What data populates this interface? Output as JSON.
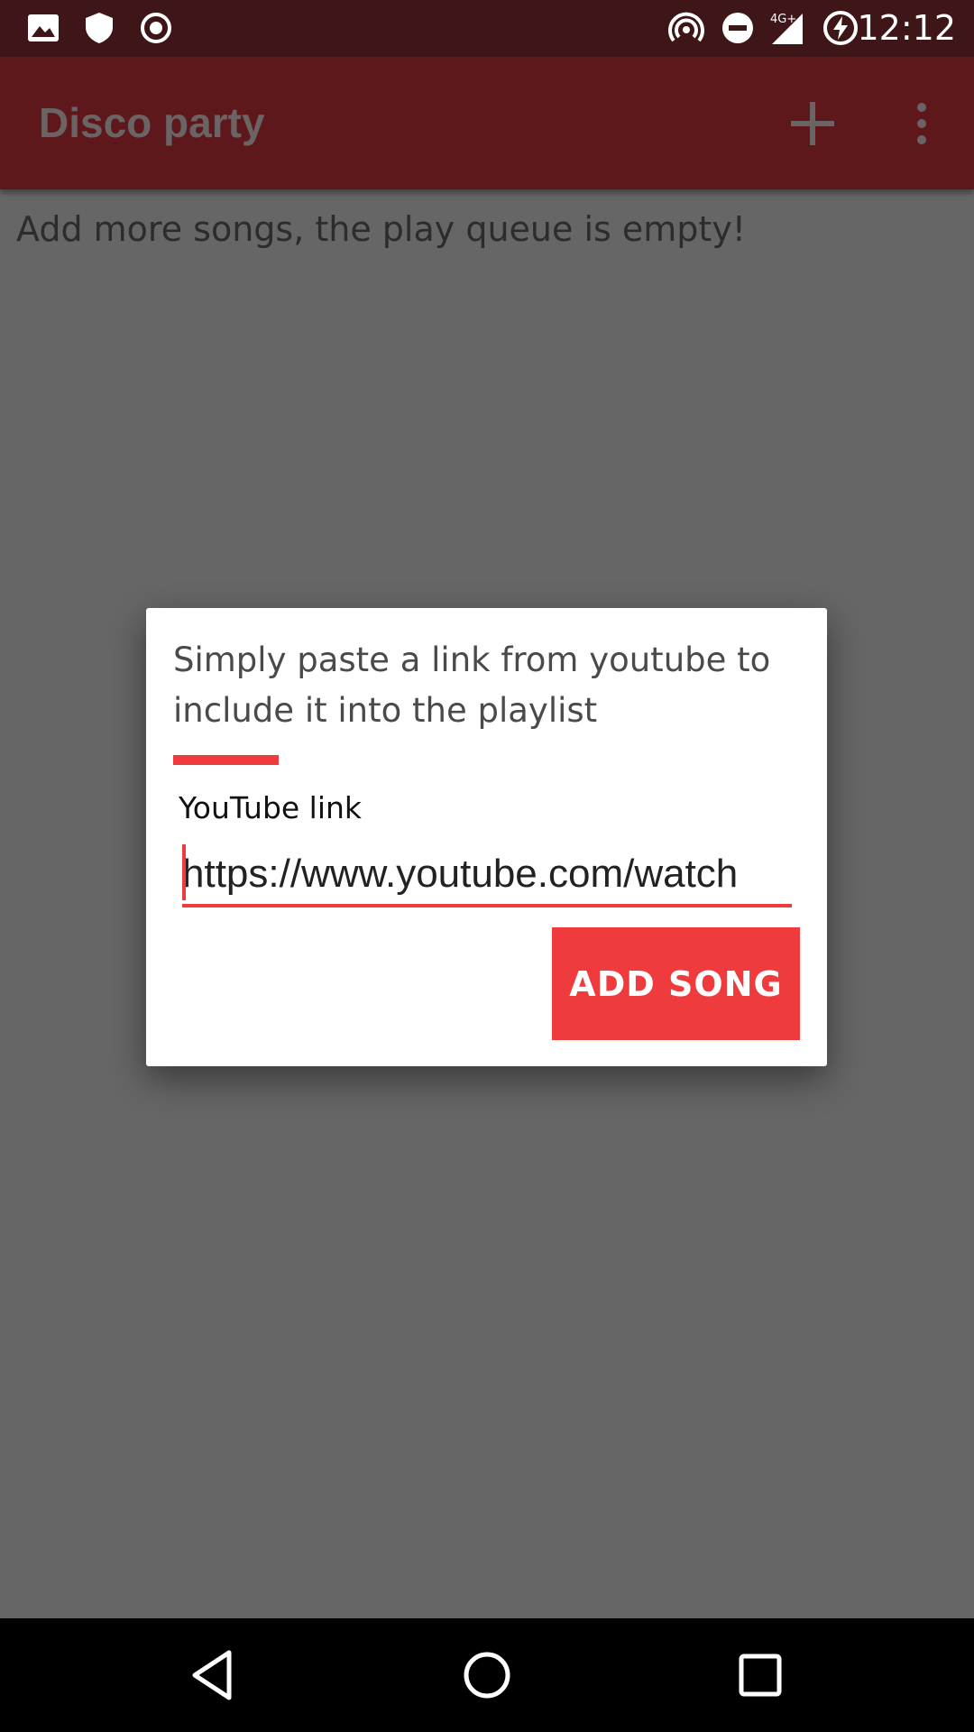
{
  "status_bar": {
    "time": "12:12",
    "network": "4G+",
    "icons": [
      "image-icon",
      "shield-icon",
      "record-icon",
      "hotspot-icon",
      "do-not-disturb-icon",
      "signal-icon",
      "battery-charging-icon"
    ]
  },
  "app_bar": {
    "title": "Disco party",
    "actions": [
      "add-icon",
      "more-vert-icon"
    ]
  },
  "main": {
    "empty_message": "Add more songs, the play queue is empty!"
  },
  "dialog": {
    "message": "Simply paste a link from youtube to include it into the playlist",
    "field_label": "YouTube link",
    "field_value": "https://www.youtube.com/watch",
    "button_label": "ADD SONG"
  },
  "nav_bar": {
    "buttons": [
      "back-icon",
      "home-icon",
      "recents-icon"
    ]
  },
  "colors": {
    "accent": "#ef3b3e",
    "app_bar": "#5e171b",
    "status_bar": "#3f1618",
    "scrim": "#666666"
  }
}
